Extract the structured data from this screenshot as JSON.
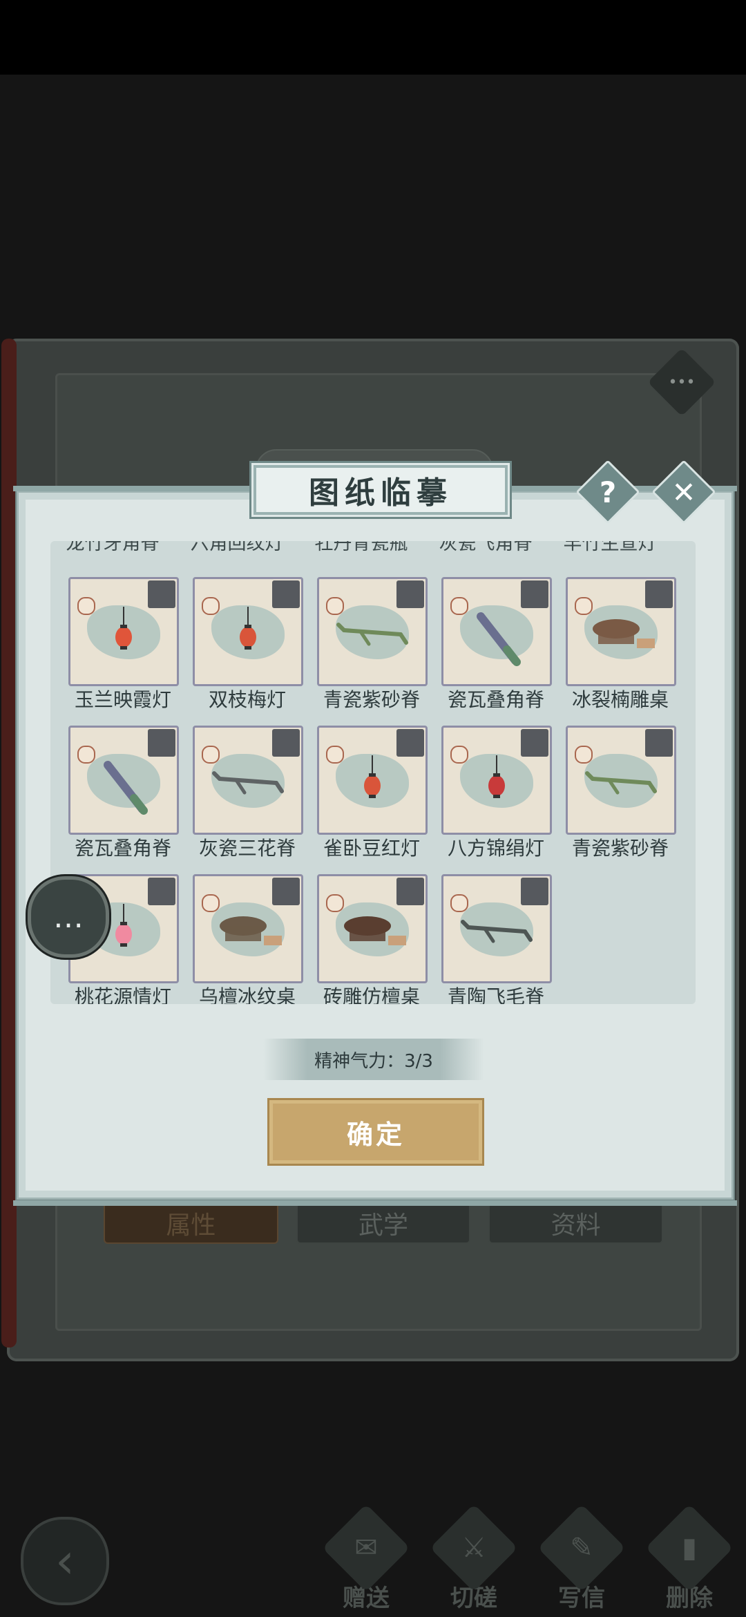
{
  "background": {
    "tabs": [
      "属性",
      "武学",
      "资料"
    ],
    "actions": [
      {
        "label": "赠送",
        "icon": "gift-scroll-icon"
      },
      {
        "label": "切磋",
        "icon": "sword-icon"
      },
      {
        "label": "写信",
        "icon": "letter-icon"
      },
      {
        "label": "删除",
        "icon": "trash-icon"
      }
    ]
  },
  "modal": {
    "title": "图纸临摹",
    "help_icon": "?",
    "close_icon": "✕",
    "cut_row": [
      "龙竹牙角脊",
      "六角回纹灯",
      "牡丹青瓷瓶",
      "灰瓷飞角脊",
      "丰竹生宣灯"
    ],
    "items": [
      {
        "label": "玉兰映霞灯",
        "type": "lamp",
        "color": "#e0553a"
      },
      {
        "label": "双枝梅灯",
        "type": "lamp",
        "color": "#d9553a"
      },
      {
        "label": "青瓷紫砂脊",
        "type": "ridge",
        "color": "#6f8a5a"
      },
      {
        "label": "瓷瓦叠角脊",
        "type": "tile",
        "color": "#6a6f8f"
      },
      {
        "label": "冰裂楠雕桌",
        "type": "table",
        "color": "#7a5a45"
      },
      {
        "label": "瓷瓦叠角脊",
        "type": "tile",
        "color": "#6a6f8f"
      },
      {
        "label": "灰瓷三花脊",
        "type": "ridge",
        "color": "#5e6364"
      },
      {
        "label": "雀卧豆红灯",
        "type": "lamp",
        "color": "#d9553a"
      },
      {
        "label": "八方锦绢灯",
        "type": "lamp",
        "color": "#c83a3a"
      },
      {
        "label": "青瓷紫砂脊",
        "type": "ridge",
        "color": "#6f8a5a"
      },
      {
        "label": "桃花源情灯",
        "type": "lamp",
        "color": "#f08aa0"
      },
      {
        "label": "乌檀冰纹桌",
        "type": "table",
        "color": "#6b5a48"
      },
      {
        "label": "砖雕仿檀桌",
        "type": "table",
        "color": "#5a3e30"
      },
      {
        "label": "青陶飞毛脊",
        "type": "ridge",
        "color": "#4e5654"
      }
    ],
    "spirit_text": "精神气力：3/3",
    "confirm_label": "确定"
  },
  "colors": {
    "accent_gold": "#c7a66d",
    "panel_bg": "#dde6e5",
    "check_box": "#56595e"
  }
}
